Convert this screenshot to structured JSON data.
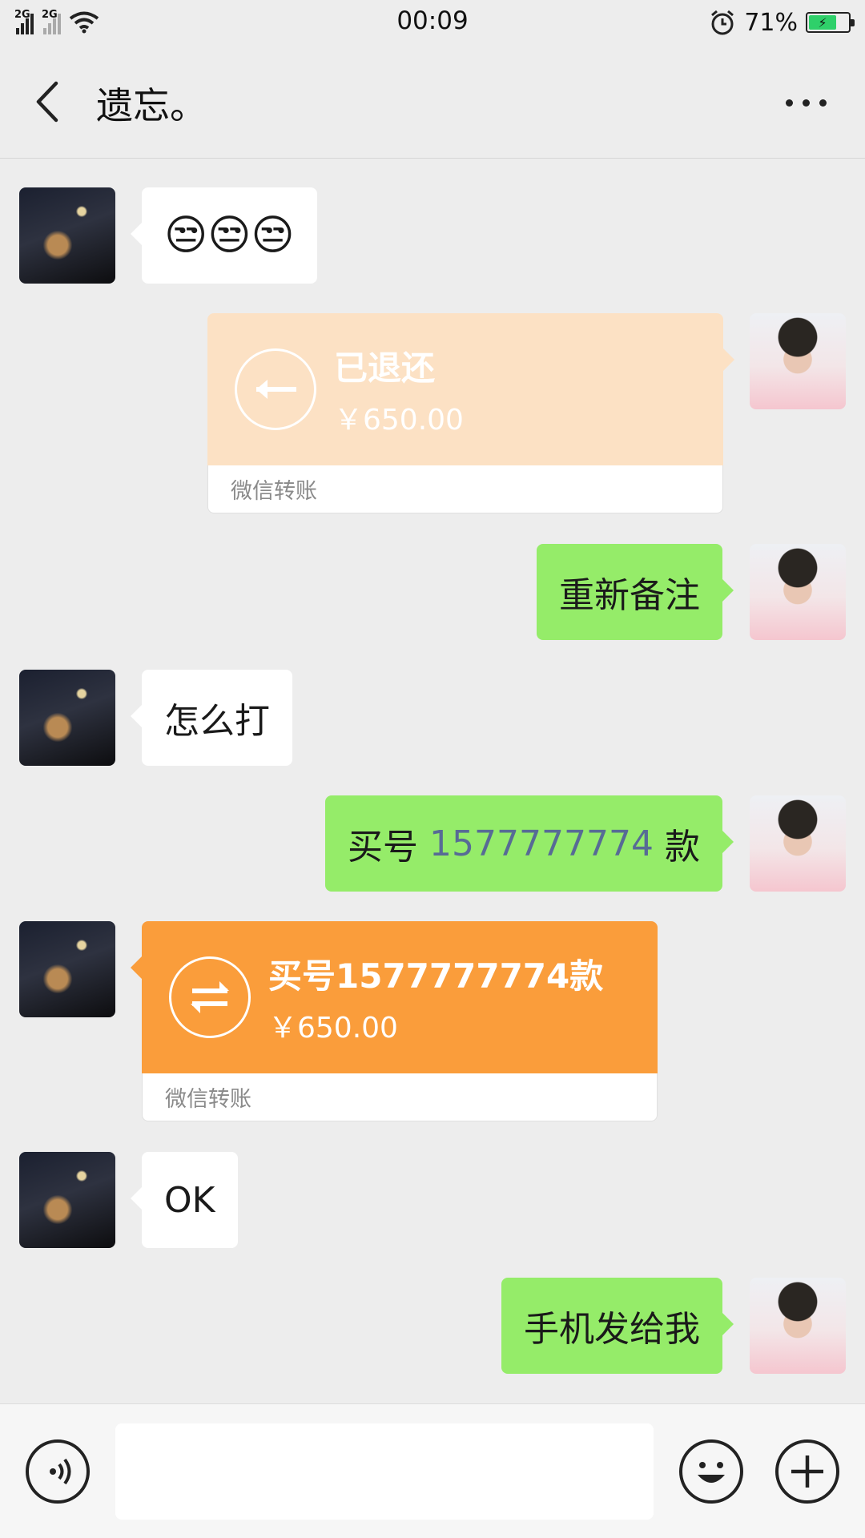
{
  "status_bar": {
    "time": "00:09",
    "signal1_label": "2G",
    "signal2_label": "2G",
    "battery_percent": "71%",
    "battery_level": 0.71
  },
  "header": {
    "title": "遗忘。"
  },
  "messages": [
    {
      "side": "left",
      "type": "text",
      "text": "😒😒😒"
    },
    {
      "side": "right",
      "type": "transfer",
      "status": "已退还",
      "amount": "￥650.00",
      "footer": "微信转账"
    },
    {
      "side": "right",
      "type": "text",
      "text": "重新备注"
    },
    {
      "side": "left",
      "type": "text",
      "text": "怎么打"
    },
    {
      "side": "right",
      "type": "text",
      "text_before": "买号 ",
      "number": "1577777774",
      "text_after": " 款"
    },
    {
      "side": "left",
      "type": "transfer",
      "status": "买号1577777774款",
      "amount": "￥650.00",
      "footer": "微信转账"
    },
    {
      "side": "left",
      "type": "text",
      "text": "OK"
    },
    {
      "side": "right",
      "type": "text",
      "text": "手机发给我"
    }
  ],
  "colors": {
    "background": "#ededed",
    "green_bubble": "#95ec69",
    "white_bubble": "#ffffff",
    "transfer_returned": "#fce1c4",
    "transfer_pending": "#fa9d3b",
    "link_number": "#576b95"
  },
  "input_bar": {
    "value": "",
    "icons": [
      "voice-icon",
      "emoji-icon",
      "plus-icon"
    ]
  }
}
